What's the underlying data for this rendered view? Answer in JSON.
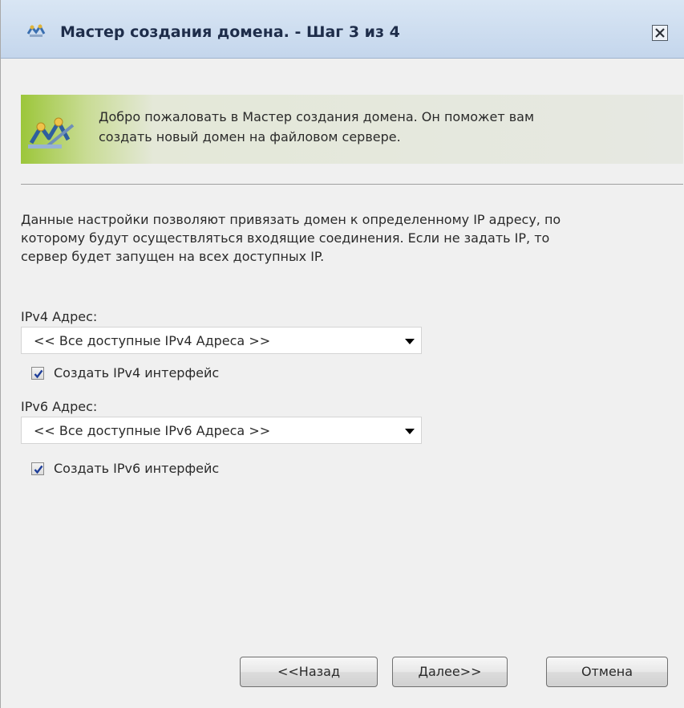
{
  "window": {
    "title": "Мастер создания домена. - Шаг 3 из 4"
  },
  "banner": {
    "line1": "Добро пожаловать в Мастер создания домена. Он поможет вам",
    "line2": "создать новый домен на файловом сервере."
  },
  "description": {
    "line1": "Данные настройки позволяют привязать домен к определенному IP адресу, по",
    "line2": "которому будут осуществляться входящие соединения. Если не задать IP, то",
    "line3": "сервер будет запущен на всех доступных IP."
  },
  "ipv4": {
    "label": "IPv4 Адрес:",
    "selected": "<< Все доступные IPv4 Адреса >>",
    "checkbox_label": "Создать IPv4 интерфейс",
    "checked": true
  },
  "ipv6": {
    "label": "IPv6 Адрес:",
    "selected": "<< Все доступные IPv6 Адреса >>",
    "checkbox_label": "Создать IPv6 интерфейс",
    "checked": true
  },
  "buttons": {
    "back": "<<Назад",
    "next": "Далее>>",
    "cancel": "Отмена"
  },
  "icons": {
    "title": "domain-wizard-icon",
    "close": "close-icon",
    "banner": "domain-wizard-icon",
    "checkmark": "checkmark-icon",
    "dropdown": "dropdown-arrow-icon"
  }
}
